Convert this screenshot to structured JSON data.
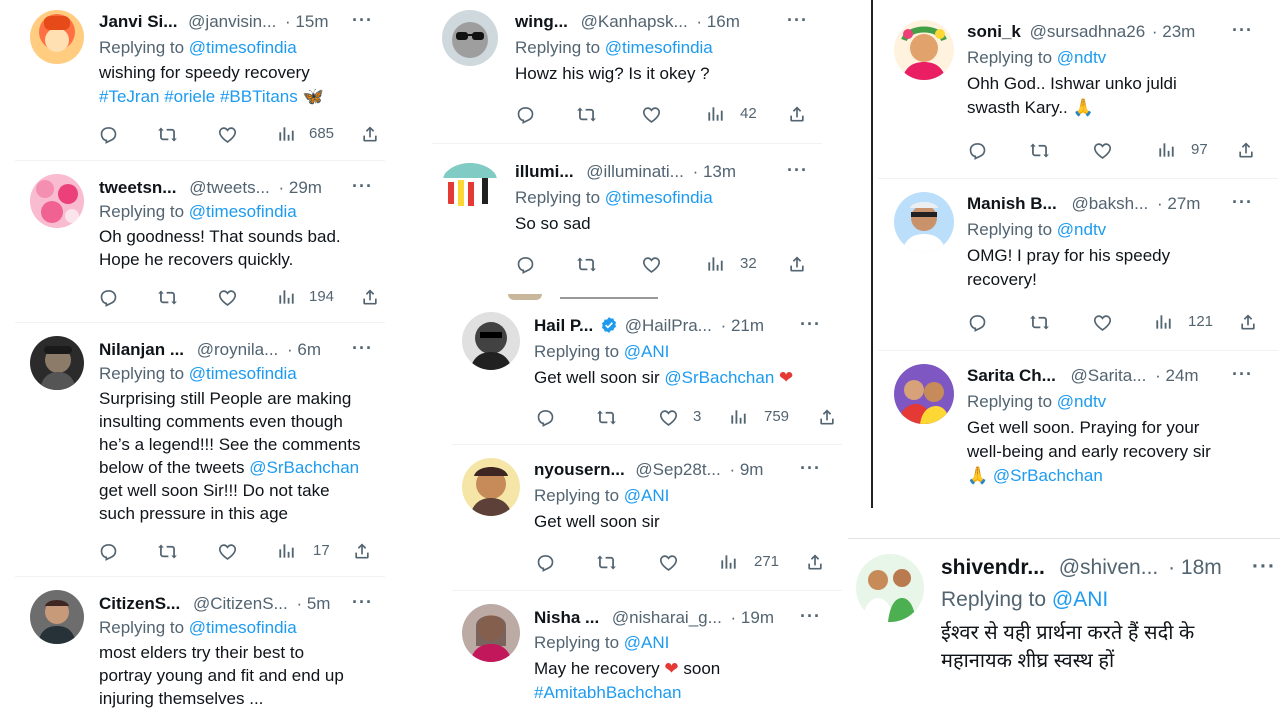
{
  "colors": {
    "link": "#1d9bf0",
    "muted": "#536471",
    "text": "#0f1419",
    "heart": "#f91880"
  },
  "col1": {
    "tweets": [
      {
        "name": "Janvi Si...",
        "handle": "@janvisin...",
        "time": "· 15m",
        "reply_prefix": "Replying to",
        "reply_to": "@timesofindia",
        "line1": "wishing for speedy recovery",
        "hashtags": "#TeJran  #oriele #BBTitans",
        "views": "685"
      },
      {
        "name": "tweetsn...",
        "handle": "@tweets...",
        "time": "· 29m",
        "reply_prefix": "Replying to",
        "reply_to": "@timesofindia",
        "line1": "Oh goodness! That sounds bad.",
        "line2": "Hope he recovers quickly.",
        "views": "194"
      },
      {
        "name": "Nilanjan ...",
        "handle": "@roynila...",
        "time": "· 6m",
        "reply_prefix": "Replying to",
        "reply_to": "@timesofindia",
        "line1": "Surprising still People are making",
        "line2": "insulting comments even though",
        "line3": "he’s a legend!!! See the comments",
        "line4_prefix": "below of the tweets",
        "line4_mention": "@SrBachchan",
        "line5": "get well soon Sir!!! Do not take",
        "line6": "such pressure in this age",
        "views": "17"
      },
      {
        "name": "CitizenS...",
        "handle": "@CitizenS...",
        "time": "· 5m",
        "reply_prefix": "Replying to",
        "reply_to": "@timesofindia",
        "line1": "most elders try their best to",
        "line2": "portray young and fit and end up",
        "line3": "injuring themselves ..."
      }
    ]
  },
  "col2": {
    "tweets": [
      {
        "name": "wing...",
        "handle": "@Kanhapsk...",
        "time": "· 16m",
        "reply_prefix": "Replying to",
        "reply_to": "@timesofindia",
        "line1": "Howz his wig? Is it okey ?",
        "views": "42"
      },
      {
        "name": "illumi...",
        "handle": "@illuminati...",
        "time": "· 13m",
        "reply_prefix": "Replying to",
        "reply_to": "@timesofindia",
        "line1": "So so sad",
        "views": "32"
      }
    ]
  },
  "col3": {
    "tweets": [
      {
        "name": "Hail P...",
        "handle": "@HailPra...",
        "time": "· 21m",
        "reply_prefix": "Replying to",
        "reply_to": "@ANI",
        "line1": "Get well soon sir",
        "mention": "@SrBachchan",
        "emoji": "❤",
        "likes": "3",
        "views": "759"
      },
      {
        "name": "nyousern...",
        "handle": "@Sep28t...",
        "time": "· 9m",
        "reply_prefix": "Replying to",
        "reply_to": "@ANI",
        "line1": "Get well soon sir",
        "views": "271"
      },
      {
        "name": "Nisha ...",
        "handle": "@nisharai_g...",
        "time": "· 19m",
        "reply_prefix": "Replying to",
        "reply_to": "@ANI",
        "line1_a": "May he recovery",
        "line1_b": "soon",
        "hashtag": "#AmitabhBachchan"
      }
    ]
  },
  "col4": {
    "tweets": [
      {
        "name": "soni_k",
        "handle": "@sursadhna26",
        "time": "· 23m",
        "reply_prefix": "Replying to",
        "reply_to": "@ndtv",
        "line1": "Ohh God.. Ishwar unko juldi",
        "line2": "swasth Kary..",
        "emoji": "🙏",
        "views": "97"
      },
      {
        "name": "Manish B...",
        "handle": "@baksh...",
        "time": "· 27m",
        "reply_prefix": "Replying to",
        "reply_to": "@ndtv",
        "line1": "OMG! I pray for his speedy",
        "line2": "recovery!",
        "views": "121"
      },
      {
        "name": "Sarita Ch...",
        "handle": "@Sarita...",
        "time": "· 24m",
        "reply_prefix": "Replying to",
        "reply_to": "@ndtv",
        "line1": "Get well soon. Praying for your",
        "line2": "well-being and early recovery  sir",
        "emoji": "🙏",
        "mention": "@SrBachchan"
      }
    ]
  },
  "col5": {
    "tweets": [
      {
        "name": "shivendr...",
        "handle": "@shiven...",
        "time": "· 18m",
        "reply_prefix": "Replying to",
        "reply_to": "@ANI",
        "line1": "ईश्वर से यही प्रार्थना करते हैं सदी के",
        "line2": "महानायक शीघ्र स्वस्थ हों"
      }
    ]
  },
  "icons": [
    "reply-icon",
    "retweet-icon",
    "like-icon",
    "views-icon",
    "share-icon",
    "more-icon",
    "verified-icon"
  ]
}
